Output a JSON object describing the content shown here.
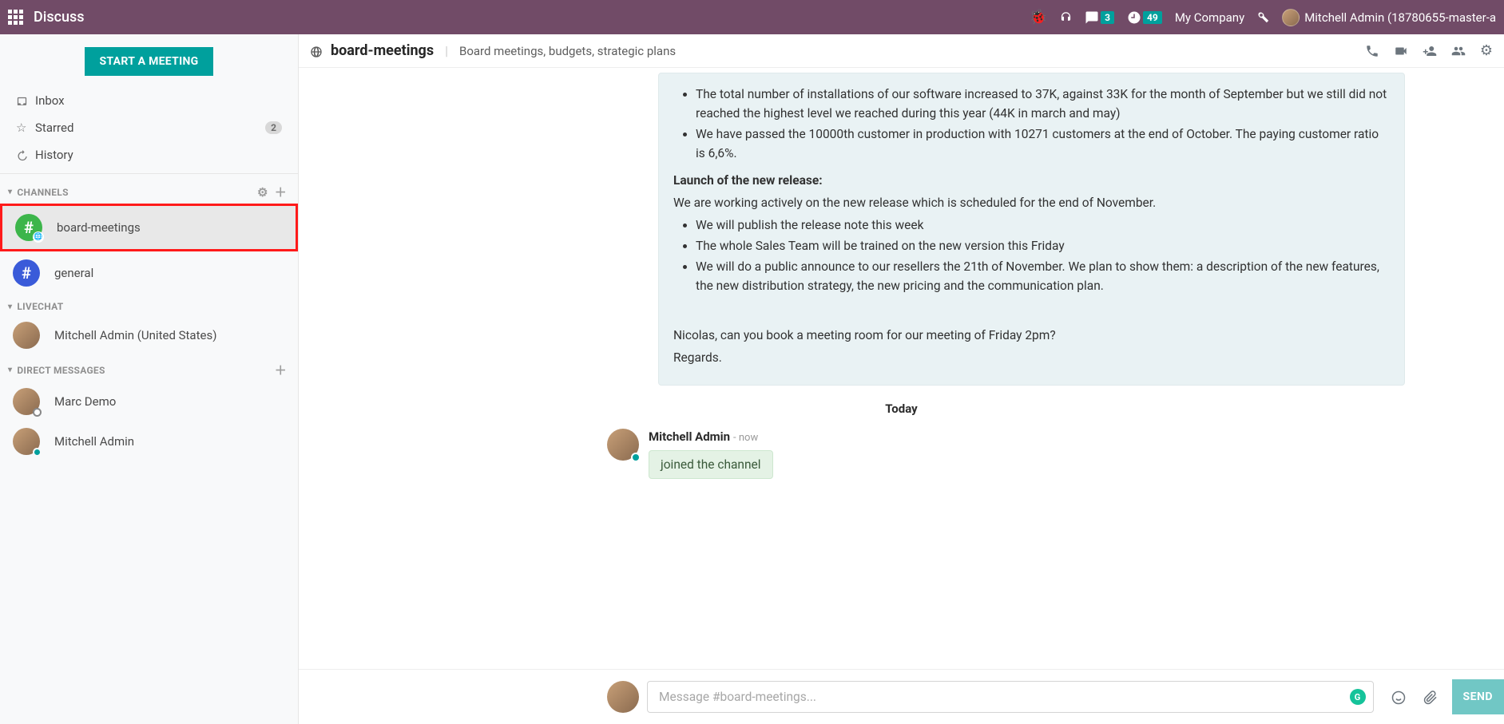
{
  "topbar": {
    "brand": "Discuss",
    "chat_badge": "3",
    "clock_badge": "49",
    "company": "My Company",
    "username": "Mitchell Admin (18780655-master-a"
  },
  "sidebar": {
    "start_meeting": "START A MEETING",
    "inbox": "Inbox",
    "starred": "Starred",
    "starred_count": "2",
    "history": "History",
    "channels_label": "CHANNELS",
    "channels": [
      {
        "name": "board-meetings"
      },
      {
        "name": "general"
      }
    ],
    "livechat_label": "LIVECHAT",
    "livechat": [
      {
        "name": "Mitchell Admin (United States)"
      }
    ],
    "dm_label": "DIRECT MESSAGES",
    "dms": [
      {
        "name": "Marc Demo"
      },
      {
        "name": "Mitchell Admin"
      }
    ]
  },
  "thread": {
    "name": "board-meetings",
    "description": "Board meetings, budgets, strategic plans"
  },
  "message1": {
    "installs": "The total number of installations of our software increased to 37K, against 33K for the month of September but we still did not reached the highest level we reached during this year (44K in march and may)",
    "customers": "We have passed the 10000th customer in production with 10271 customers at the end of October. The paying customer ratio is 6,6%.",
    "launch_head": "Launch of the new release:",
    "launch_intro": "We are working actively on the new release which is scheduled for the end of November.",
    "rel1": "We will publish the release note this week",
    "rel2": "The whole Sales Team will be trained on the new version this Friday",
    "rel3": "We will do a public announce to our resellers the 21th of November. We plan to show them: a description of the new features, the new distribution strategy, the new pricing and the communication plan.",
    "closing1": "Nicolas, can you book a meeting room for our meeting of Friday 2pm?",
    "closing2": "Regards."
  },
  "divider": "Today",
  "message2": {
    "author": "Mitchell Admin",
    "time": "- now",
    "text": "joined the channel"
  },
  "composer": {
    "placeholder": "Message #board-meetings...",
    "send": "SEND"
  }
}
